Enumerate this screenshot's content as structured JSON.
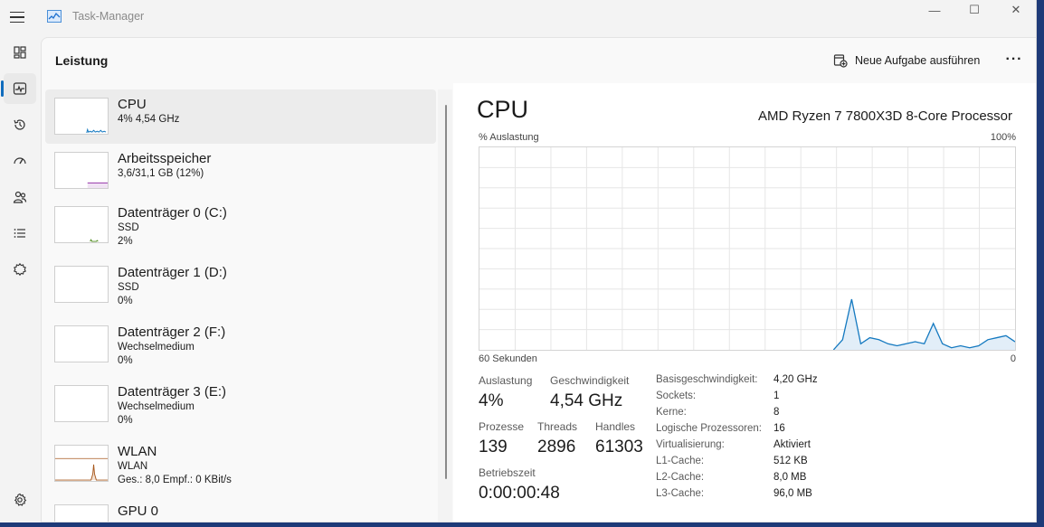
{
  "window": {
    "title": "Task-Manager",
    "controls": [
      "—",
      "☐",
      "✕"
    ]
  },
  "nav": {
    "items": [
      {
        "icon": "processes-icon"
      },
      {
        "icon": "performance-icon",
        "active": true
      },
      {
        "icon": "app-history-icon"
      },
      {
        "icon": "startup-apps-icon"
      },
      {
        "icon": "users-icon"
      },
      {
        "icon": "details-icon"
      },
      {
        "icon": "services-icon"
      }
    ],
    "settings_icon": "gear-icon"
  },
  "header": {
    "title": "Leistung",
    "run_task_label": "Neue Aufgabe ausführen",
    "more_label": "···"
  },
  "resources": [
    {
      "name": "CPU",
      "line1": "4% 4,54 GHz",
      "line2": "",
      "color": "#1479c0",
      "selected": true
    },
    {
      "name": "Arbeitsspeicher",
      "line1": "3,6/31,1 GB (12%)",
      "line2": "",
      "color": "#8b1fa0"
    },
    {
      "name": "Datenträger 0 (C:)",
      "line1": "SSD",
      "line2": "2%",
      "color": "#4d8a1c"
    },
    {
      "name": "Datenträger 1 (D:)",
      "line1": "SSD",
      "line2": "0%",
      "color": "#4d8a1c"
    },
    {
      "name": "Datenträger 2 (F:)",
      "line1": "Wechselmedium",
      "line2": "0%",
      "color": "#4d8a1c"
    },
    {
      "name": "Datenträger 3 (E:)",
      "line1": "Wechselmedium",
      "line2": "0%",
      "color": "#4d8a1c"
    },
    {
      "name": "WLAN",
      "line1": "WLAN",
      "line2": "Ges.: 8,0 Empf.: 0 KBit/s",
      "color": "#a8591e"
    },
    {
      "name": "GPU 0",
      "line1": "",
      "line2": "",
      "color": "#1479c0"
    }
  ],
  "detail": {
    "title": "CPU",
    "model": "AMD Ryzen 7 7800X3D 8-Core Processor",
    "graph": {
      "ylabel": "% Auslastung",
      "ymax_label": "100%",
      "xlabel": "60 Sekunden",
      "xmin_label": "0",
      "color": "#1479c0",
      "values": [
        0,
        0,
        0,
        0,
        0,
        0,
        0,
        0,
        0,
        0,
        0,
        0,
        0,
        0,
        0,
        0,
        0,
        0,
        0,
        0,
        0,
        0,
        0,
        0,
        0,
        0,
        0,
        0,
        0,
        0,
        0,
        0,
        0,
        0,
        0,
        0,
        0,
        0,
        0,
        0,
        5,
        25,
        3,
        6,
        5,
        3,
        2,
        3,
        4,
        3,
        13,
        3,
        1,
        2,
        1,
        2,
        5,
        6,
        7,
        4
      ]
    },
    "stats": {
      "util_label": "Auslastung",
      "util_value": "4%",
      "speed_label": "Geschwindigkeit",
      "speed_value": "4,54 GHz",
      "processes_label": "Prozesse",
      "processes_value": "139",
      "threads_label": "Threads",
      "threads_value": "2896",
      "handles_label": "Handles",
      "handles_value": "61303",
      "uptime_label": "Betriebszeit",
      "uptime_value": "0:00:00:48"
    },
    "specs": [
      {
        "k": "Basisgeschwindigkeit:",
        "v": "4,20 GHz"
      },
      {
        "k": "Sockets:",
        "v": "1"
      },
      {
        "k": "Kerne:",
        "v": "8"
      },
      {
        "k": "Logische Prozessoren:",
        "v": "16"
      },
      {
        "k": "Virtualisierung:",
        "v": "Aktiviert"
      },
      {
        "k": "L1-Cache:",
        "v": "512 KB"
      },
      {
        "k": "L2-Cache:",
        "v": "8,0 MB"
      },
      {
        "k": "L3-Cache:",
        "v": "96,0 MB"
      }
    ]
  }
}
